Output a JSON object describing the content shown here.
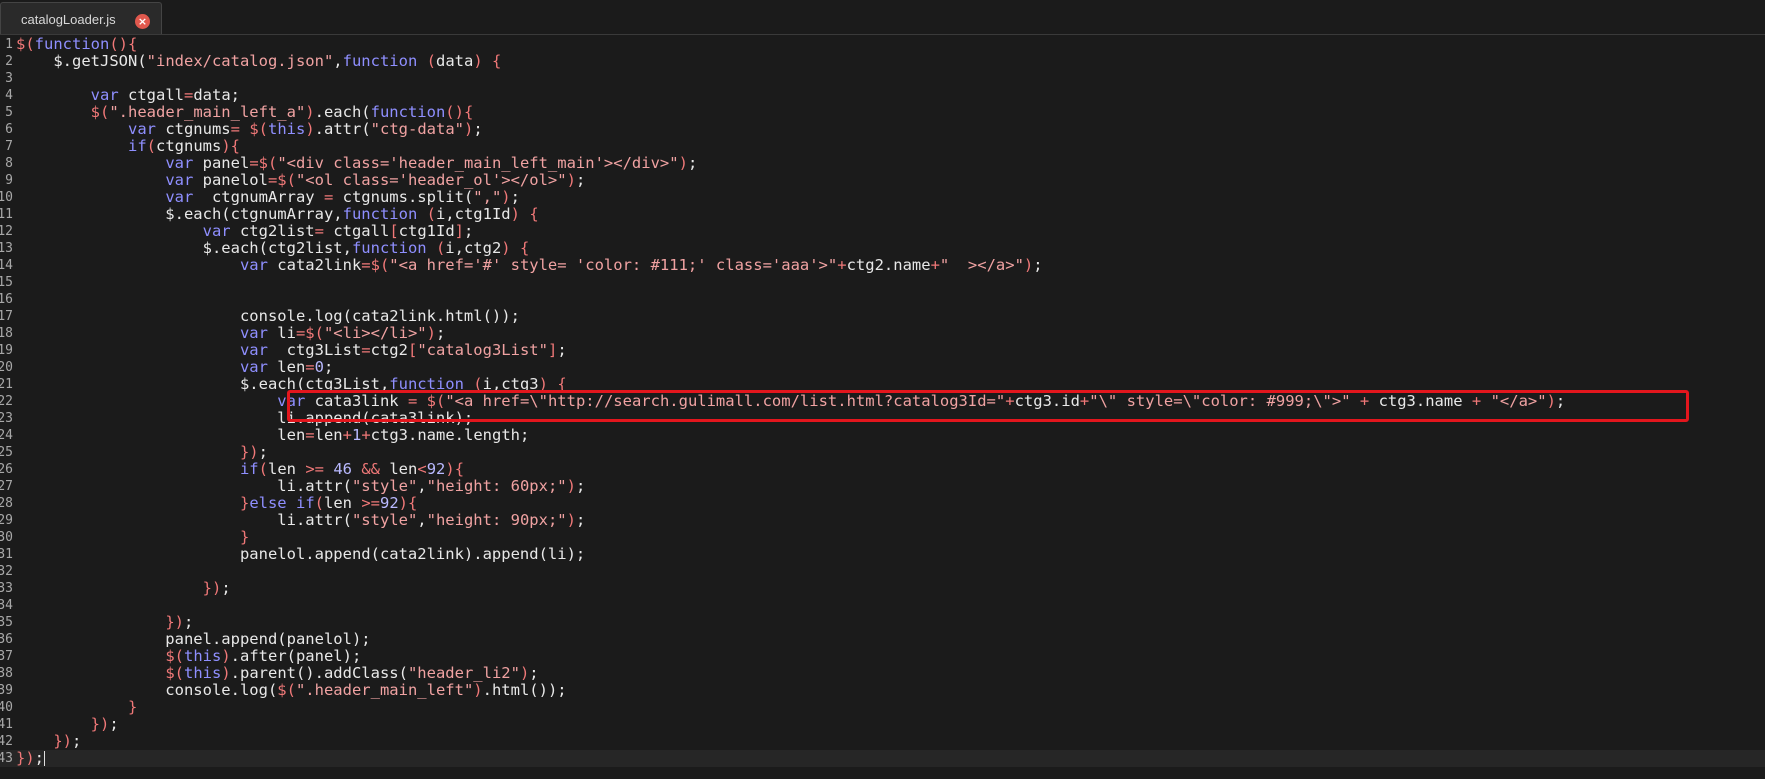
{
  "tab": {
    "label": "catalogLoader.js",
    "close_glyph": "×"
  },
  "lines": [
    "<span class=\"p\">$(</span><span class=\"k\">function</span><span class=\"p\">(){</span>",
    "    $.getJSON(<span class=\"s\">\"index/catalog.json\"</span>,<span class=\"k\">function</span> <span class=\"p\">(</span>data<span class=\"p\">)</span> <span class=\"p\">{</span>",
    "",
    "        <span class=\"k\">var</span> ctgall<span class=\"p\">=</span>data;",
    "        <span class=\"p\">$(</span><span class=\"s\">\".header_main_left_a\"</span><span class=\"p\">)</span>.each(<span class=\"k\">function</span><span class=\"p\">(){</span>",
    "            <span class=\"k\">var</span> ctgnums<span class=\"p\">=</span> <span class=\"p\">$(</span><span class=\"k\">this</span><span class=\"p\">)</span>.attr(<span class=\"s\">\"ctg-data\"</span><span class=\"p\">)</span>;",
    "            <span class=\"k\">if</span><span class=\"p\">(</span>ctgnums<span class=\"p\">){</span>",
    "                <span class=\"k\">var</span> panel<span class=\"p\">=$(</span><span class=\"s\">\"&lt;div class='header_main_left_main'&gt;&lt;/div&gt;\"</span><span class=\"p\">)</span>;",
    "                <span class=\"k\">var</span> panelol<span class=\"p\">=$(</span><span class=\"s\">\"&lt;ol class='header_ol'&gt;&lt;/ol&gt;\"</span><span class=\"p\">)</span>;",
    "                <span class=\"k\">var</span>  ctgnumArray <span class=\"p\">=</span> ctgnums.split(<span class=\"s\">\",\"</span><span class=\"p\">)</span>;",
    "                $.each(ctgnumArray,<span class=\"k\">function</span> <span class=\"p\">(</span>i,ctg1Id<span class=\"p\">)</span> <span class=\"p\">{</span>",
    "                    <span class=\"k\">var</span> ctg2list<span class=\"p\">=</span> ctgall<span class=\"p\">[</span>ctg1Id<span class=\"p\">]</span>;",
    "                    $.each(ctg2list,<span class=\"k\">function</span> <span class=\"p\">(</span>i,ctg2<span class=\"p\">)</span> <span class=\"p\">{</span>",
    "                        <span class=\"k\">var</span> cata2link<span class=\"p\">=$(</span><span class=\"s\">\"&lt;a href='#' style= 'color: #111;' class='aaa'&gt;\"</span><span class=\"p\">+</span>ctg2.name<span class=\"p\">+</span><span class=\"s\">\"  &gt;&lt;/a&gt;\"</span><span class=\"p\">)</span>;",
    "",
    "",
    "                        console.log(cata2link.html());",
    "                        <span class=\"k\">var</span> li<span class=\"p\">=$(</span><span class=\"s\">\"&lt;li&gt;&lt;/li&gt;\"</span><span class=\"p\">)</span>;",
    "                        <span class=\"k\">var</span>  ctg3List<span class=\"p\">=</span>ctg2<span class=\"p\">[</span><span class=\"s\">\"catalog3List\"</span><span class=\"p\">]</span>;",
    "                        <span class=\"k\">var</span> len<span class=\"p\">=</span><span class=\"n\">0</span>;",
    "                        $.each(ctg3List,<span class=\"k\">function</span> <span class=\"p\">(</span>i,ctg3<span class=\"p\">)</span> <span class=\"p\">{</span>",
    "                            <span class=\"k\">var</span> cata3link <span class=\"p\">=</span> <span class=\"p\">$(</span><span class=\"s\">\"&lt;a href=\\\"http://search.gulimall.com/list.html?catalog3Id=\"</span><span class=\"p\">+</span>ctg3.id<span class=\"p\">+</span><span class=\"s\">\"\\\" style=\\\"color: #999;\\\"&gt;\"</span> <span class=\"p\">+</span> ctg3.name <span class=\"p\">+</span> <span class=\"s\">\"&lt;/a&gt;\"</span><span class=\"p\">)</span>;",
    "                            li.append(cata3link);",
    "                            len<span class=\"p\">=</span>len<span class=\"p\">+</span><span class=\"n\">1</span><span class=\"p\">+</span>ctg3.name.length;",
    "                        <span class=\"p\">})</span>;",
    "                        <span class=\"k\">if</span><span class=\"p\">(</span>len <span class=\"p\">&gt;=</span> <span class=\"n\">46</span> <span class=\"p\">&amp;&amp;</span> len<span class=\"p\">&lt;</span><span class=\"n\">92</span><span class=\"p\">){</span>",
    "                            li.attr(<span class=\"s\">\"style\"</span>,<span class=\"s\">\"height: 60px;\"</span><span class=\"p\">)</span>;",
    "                        <span class=\"p\">}</span><span class=\"k\">else</span> <span class=\"k\">if</span><span class=\"p\">(</span>len <span class=\"p\">&gt;=</span><span class=\"n\">92</span><span class=\"p\">){</span>",
    "                            li.attr(<span class=\"s\">\"style\"</span>,<span class=\"s\">\"height: 90px;\"</span><span class=\"p\">)</span>;",
    "                        <span class=\"p\">}</span>",
    "                        panelol.append(cata2link).append(li);",
    "",
    "                    <span class=\"p\">})</span>;",
    "",
    "                <span class=\"p\">})</span>;",
    "                panel.append(panelol);",
    "                <span class=\"p\">$(</span><span class=\"k\">this</span><span class=\"p\">)</span>.after(panel);",
    "                <span class=\"p\">$(</span><span class=\"k\">this</span><span class=\"p\">)</span>.parent().addClass(<span class=\"s\">\"header_li2\"</span><span class=\"p\">)</span>;",
    "                console.log(<span class=\"p\">$(</span><span class=\"s\">\".header_main_left\"</span><span class=\"p\">)</span>.html());",
    "            <span class=\"p\">}</span>",
    "        <span class=\"p\">})</span>;",
    "    <span class=\"p\">})</span>;",
    "<span class=\"p\">})</span>;"
  ],
  "line_numbers": [
    "1",
    "2",
    "3",
    "4",
    "5",
    "6",
    "7",
    "8",
    "9",
    "10",
    "11",
    "12",
    "13",
    "14",
    "15",
    "16",
    "17",
    "18",
    "19",
    "20",
    "21",
    "22",
    "23",
    "24",
    "25",
    "26",
    "27",
    "28",
    "29",
    "30",
    "31",
    "32",
    "33",
    "34",
    "35",
    "36",
    "37",
    "38",
    "39",
    "40",
    "41",
    "42",
    "43"
  ],
  "current_line": 43,
  "highlighted_line": 22
}
